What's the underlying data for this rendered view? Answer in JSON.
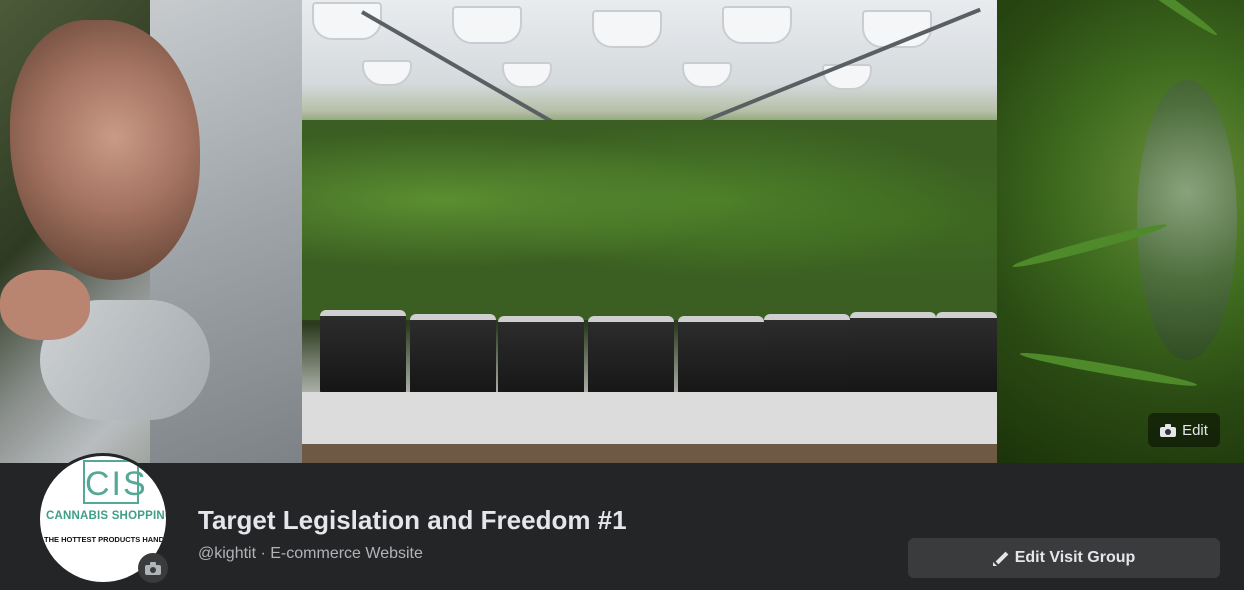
{
  "cover": {
    "edit_label": "Edit",
    "icon": "camera-icon"
  },
  "profile": {
    "logo_letters": "CIS",
    "logo_name": "CANNABIS SHOPPING",
    "logo_tagline": "THE HOTTEST PRODUCTS HAND-TEST",
    "avatar_edit_icon": "camera-icon"
  },
  "page": {
    "title": "Target Legislation and Freedom #1",
    "meta": "@kightit · E-commerce Website"
  },
  "actions": {
    "edit_visit_group_label": "Edit Visit Group",
    "edit_icon": "pencil-icon"
  },
  "colors": {
    "background": "#242526",
    "button_bg": "#3a3b3c",
    "text_primary": "#e4e6eb",
    "text_secondary": "#b0b3b8",
    "logo_accent": "#55a895"
  }
}
